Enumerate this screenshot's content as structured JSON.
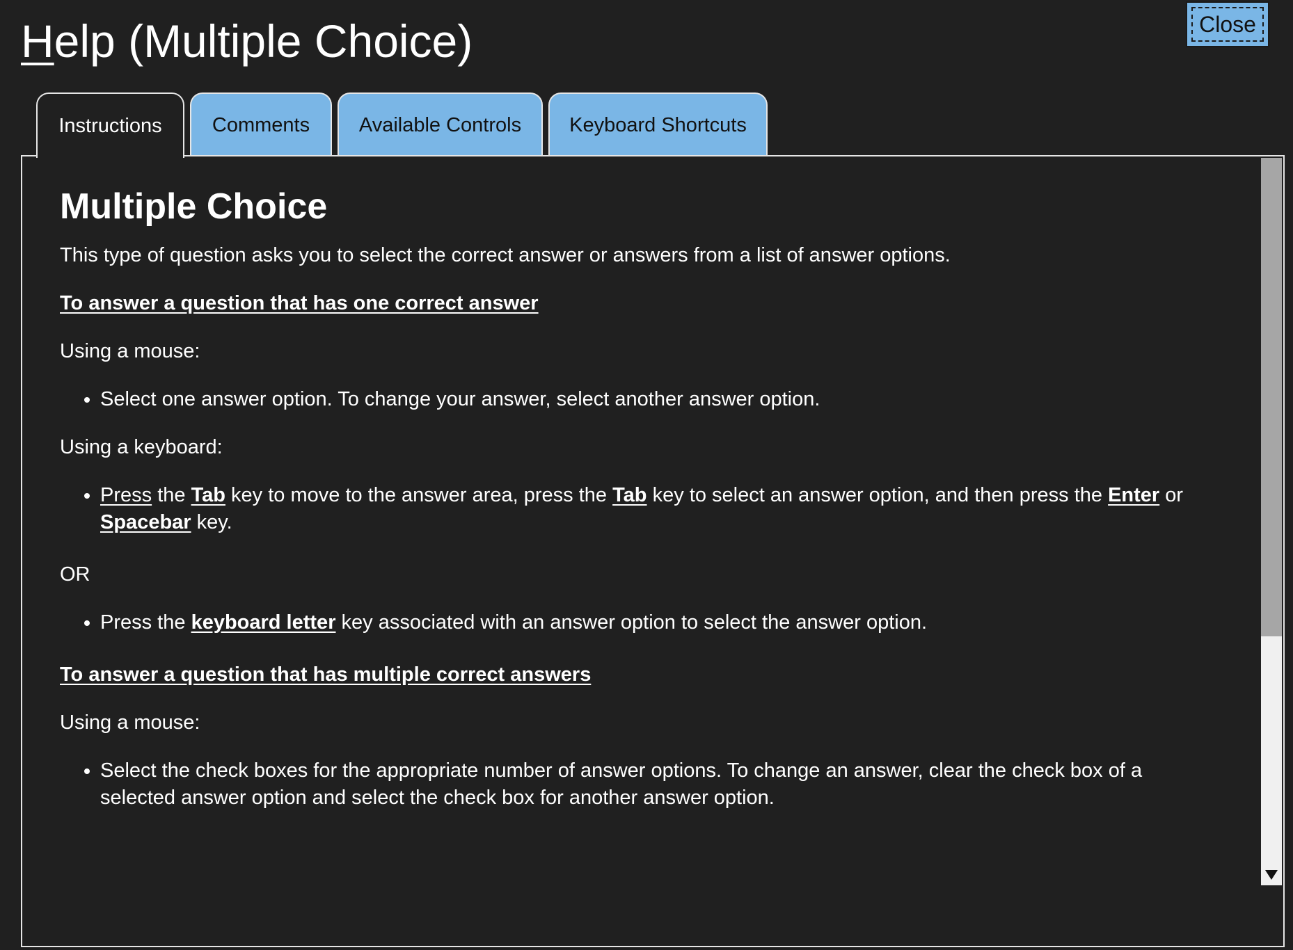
{
  "window": {
    "title_first_letter": "H",
    "title_rest": "elp (Multiple Choice)",
    "close_label": "Close"
  },
  "tabs": [
    {
      "label": "Instructions",
      "active": true
    },
    {
      "label": "Comments",
      "active": false
    },
    {
      "label": "Available Controls",
      "active": false
    },
    {
      "label": "Keyboard Shortcuts",
      "active": false
    }
  ],
  "content": {
    "heading": "Multiple Choice",
    "intro": "This type of question asks you to select the correct answer or answers from a list of answer options.",
    "section1": {
      "heading": "To answer a question that has one correct answer",
      "mouse_label": "Using a mouse:",
      "mouse_item": "Select one answer option.  To change your answer, select another answer option.",
      "keyboard_label": "Using a keyboard:",
      "kb_item": {
        "press": "Press",
        "t1": " the ",
        "tab1": "Tab",
        "t2": " key to move to the answer area, press the ",
        "tab2": "Tab",
        "t3": " key to select an answer option, and then press the ",
        "enter": "Enter",
        "t4": " or ",
        "spacebar": "Spacebar",
        "t5": " key."
      },
      "or_label": "OR",
      "letter_item": {
        "t1": "Press the ",
        "kw": "keyboard letter",
        "t2": " key associated with an answer option to select the answer option."
      }
    },
    "section2": {
      "heading": "To answer a question that has multiple correct answers",
      "mouse_label": "Using a mouse:",
      "mouse_item": "Select the check boxes for the appropriate number of answer options. To change an answer, clear the check box of a selected answer option and select the check box for another answer option."
    }
  },
  "colors": {
    "background": "#202020",
    "tab_inactive": "#7ab6e6",
    "close_button": "#7ab6e6",
    "scroll_thumb": "#a6a6a6",
    "scroll_track": "#f0f0f0"
  },
  "icons": {
    "scroll_down": "triangle-down-icon"
  }
}
